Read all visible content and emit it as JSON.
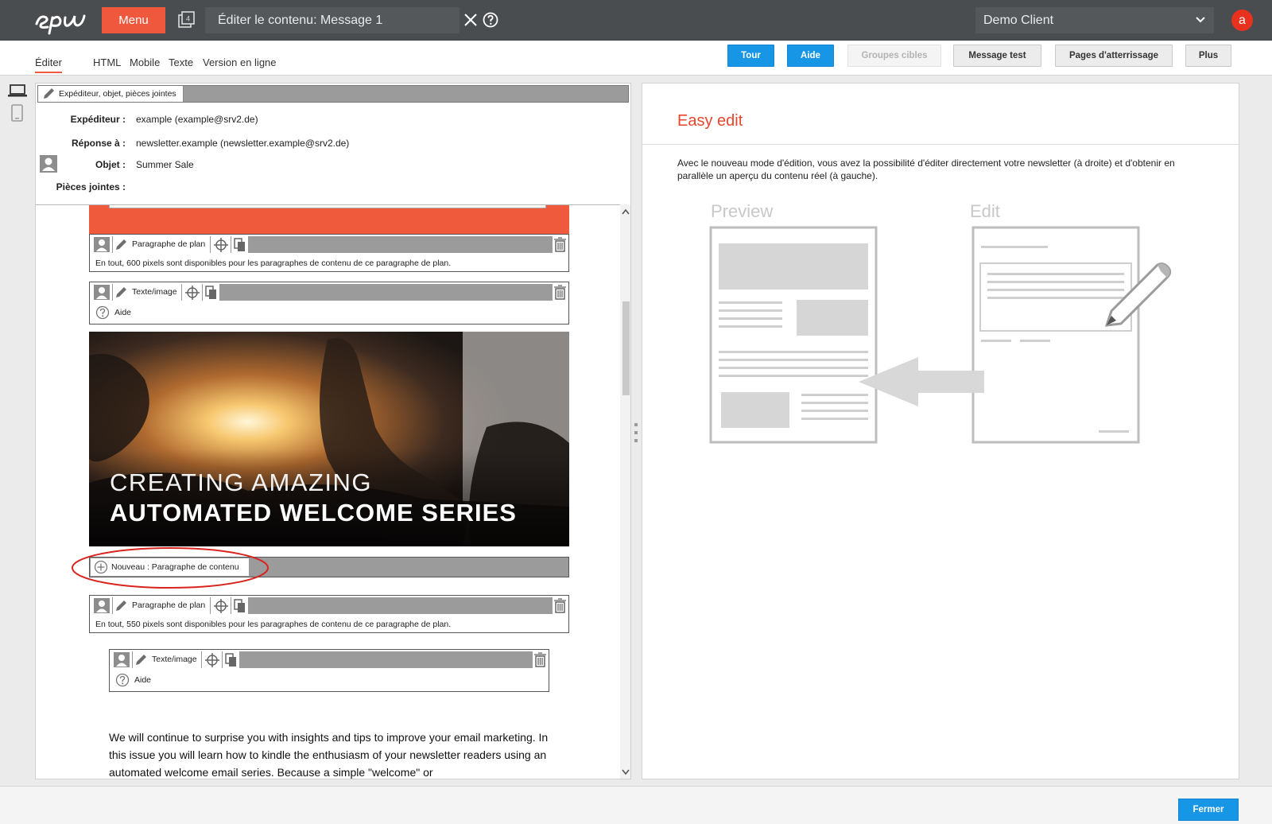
{
  "topbar": {
    "logo_text": "epi",
    "menu_label": "Menu",
    "tabs_count": "4",
    "title": "Éditer le contenu: Message 1",
    "client": "Demo Client",
    "avatar_letter": "a"
  },
  "modes": [
    "Éditer",
    "HTML",
    "Mobile",
    "Texte",
    "Version en ligne"
  ],
  "toolbar": {
    "tour": "Tour",
    "aide": "Aide",
    "groupes": "Groupes cibles",
    "message_test": "Message test",
    "pages": "Pages d'atterrissage",
    "plus": "Plus"
  },
  "header": {
    "bar_label": "Expéditeur, objet, pièces jointes",
    "sender_label": "Expéditeur :",
    "sender_value": "example (example@srv2.de)",
    "reply_label": "Réponse à :",
    "reply_value": "newsletter.example (newsletter.example@srv2.de)",
    "subject_label": "Objet :",
    "subject_value": "Summer Sale",
    "attachments_label": "Pièces jointes :"
  },
  "blocks": {
    "plan1_label": "Paragraphe de plan",
    "plan1_text": "En tout, 600 pixels sont disponibles pour les paragraphes de contenu de ce paragraphe de plan.",
    "textimg1_label": "Texte/image",
    "textimg1_help": "Aide",
    "hero_line1": "CREATING AMAZING",
    "hero_line2": "AUTOMATED WELCOME SERIES",
    "new_label": "Nouveau : Paragraphe de contenu",
    "plan2_label": "Paragraphe de plan",
    "plan2_text": "En tout, 550 pixels sont disponibles pour les paragraphes de contenu de ce paragraphe de plan.",
    "textimg2_label": "Texte/image",
    "textimg2_help": "Aide",
    "body_text": "We will continue to surprise you with insights and tips to improve your email marketing. In this issue you will learn how to kindle the enthusiasm of your newsletter readers using an automated welcome email series. Because a simple \"welcome\" or"
  },
  "right": {
    "title": "Easy edit",
    "description": "Avec le nouveau mode d'édition, vous avez la possibilité d'éditer directement votre newsletter (à droite) et d'obtenir en parallèle un aperçu du contenu réel (à gauche).",
    "preview_label": "Preview",
    "edit_label": "Edit"
  },
  "footer": {
    "close": "Fermer"
  },
  "colors": {
    "accent": "#f0583e",
    "primary_button": "#1896e6",
    "topbar": "#4a4d50"
  }
}
